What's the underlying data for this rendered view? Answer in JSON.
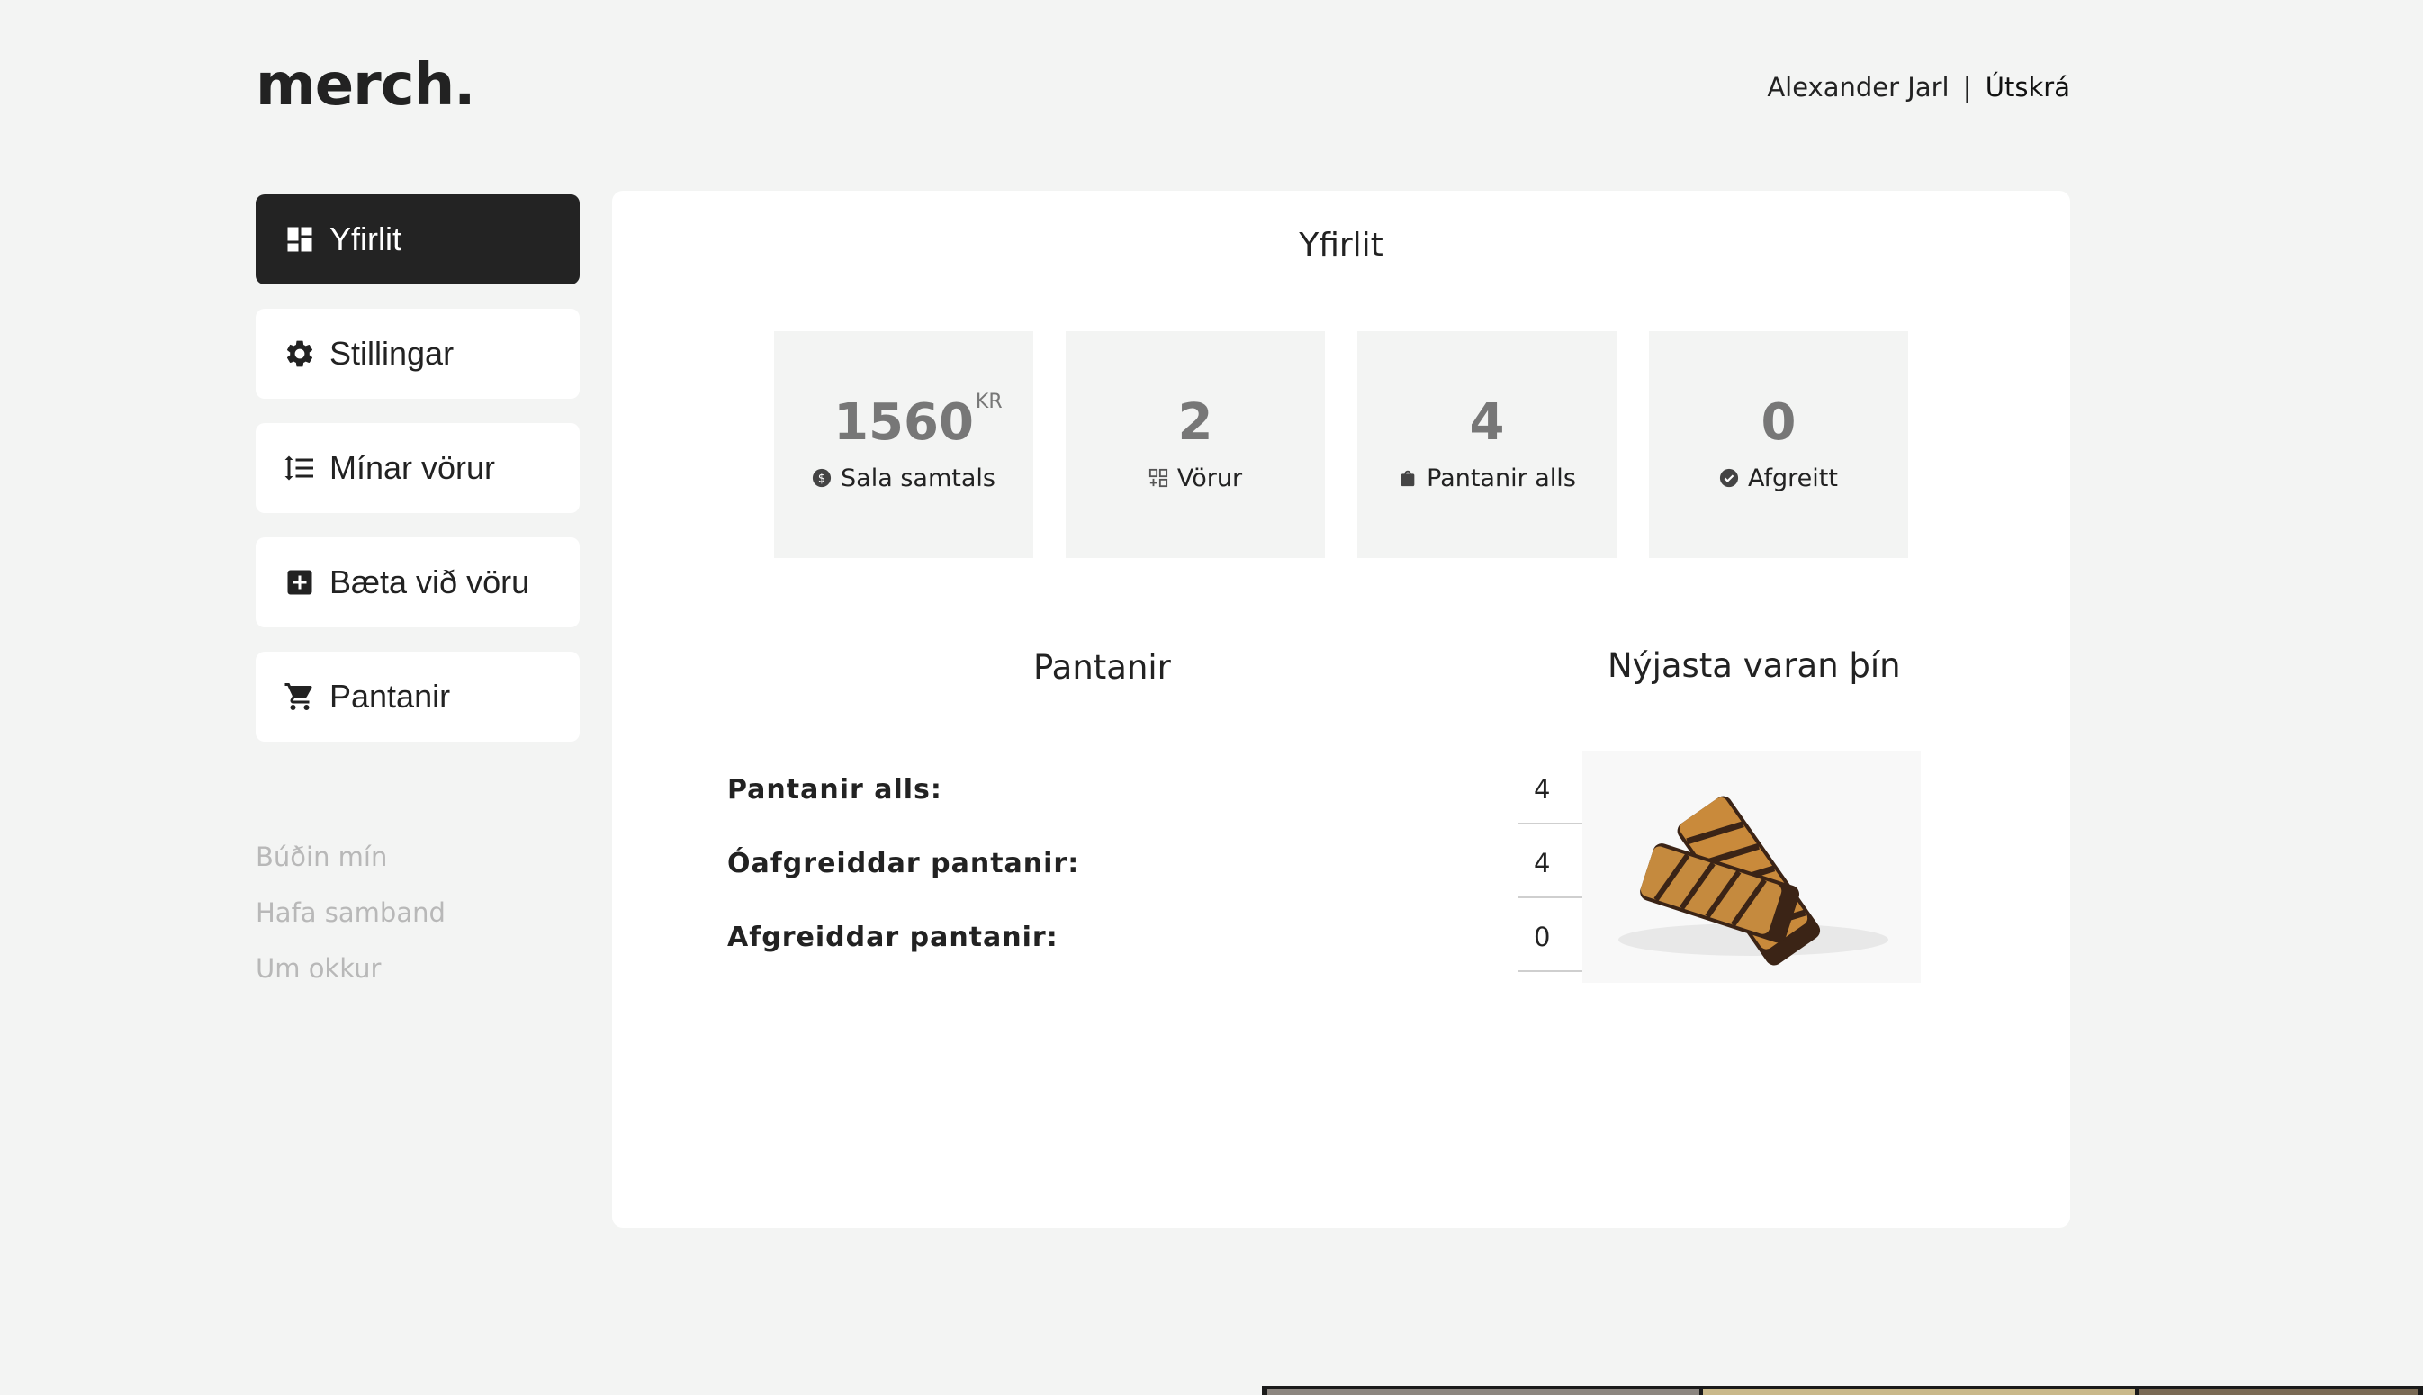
{
  "app": {
    "logo": "merch."
  },
  "header": {
    "user_name": "Alexander Jarl",
    "separator": "|",
    "logout_label": "Útskrá"
  },
  "nav": {
    "items": [
      {
        "label": "Yfirlit",
        "icon": "dashboard-icon",
        "active": true
      },
      {
        "label": "Stillingar",
        "icon": "gear-icon",
        "active": false
      },
      {
        "label": "Mínar vörur",
        "icon": "sort-list-icon",
        "active": false
      },
      {
        "label": "Bæta við vöru",
        "icon": "plus-square-icon",
        "active": false
      },
      {
        "label": "Pantanir",
        "icon": "cart-icon",
        "active": false
      }
    ]
  },
  "footer_links": [
    "Búðin mín",
    "Hafa samband",
    "Um okkur"
  ],
  "overview": {
    "title": "Yfirlit",
    "stats": [
      {
        "value": "1560",
        "unit": "KR",
        "label": "Sala samtals",
        "icon": "dollar-circle-icon"
      },
      {
        "value": "2",
        "unit": "",
        "label": "Vörur",
        "icon": "products-grid-icon"
      },
      {
        "value": "4",
        "unit": "",
        "label": "Pantanir alls",
        "icon": "bag-icon"
      },
      {
        "value": "0",
        "unit": "",
        "label": "Afgreitt",
        "icon": "check-circle-icon"
      }
    ]
  },
  "orders": {
    "title": "Pantanir",
    "rows": [
      {
        "label": "Pantanir alls:",
        "value": "4"
      },
      {
        "label": "Óafgreiddar pantanir:",
        "value": "4"
      },
      {
        "label": "Afgreiddar pantanir:",
        "value": "0"
      }
    ]
  },
  "newest": {
    "title": "Nýjasta varan þín",
    "image": "chocolate-granola-bar-image"
  },
  "colors": {
    "background": "#f3f4f3",
    "active_nav": "#232323",
    "muted_text": "#b8b8b8",
    "stat_value": "#777777"
  }
}
